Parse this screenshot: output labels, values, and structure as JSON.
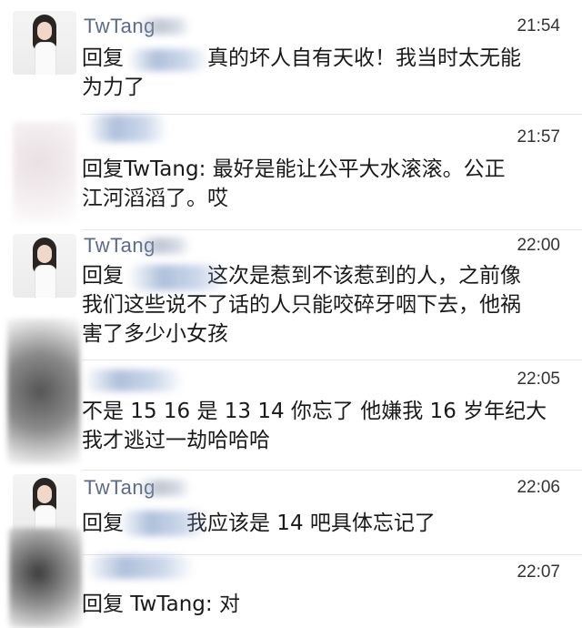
{
  "comments": [
    {
      "username": "TwTang",
      "time": "21:54",
      "text_line1": "回复　　　　真的坏人自有天收！我当时太无能",
      "text_line2": "为力了"
    },
    {
      "username": "",
      "time": "21:57",
      "text_line1": "回复TwTang: 最好是能让公平大水滚滚。公正",
      "text_line2": "江河滔滔了。哎"
    },
    {
      "username": "TwTang",
      "time": "22:00",
      "text_line1": "回复　　　　这次是惹到不该惹到的人，之前像",
      "text_line2": "我们这些说不了话的人只能咬碎牙咽下去，他祸",
      "text_line3": "害了多少小女孩"
    },
    {
      "username": "",
      "time": "22:05",
      "text_line1": "不是 15 16 是 13 14 你忘了 他嫌我 16 岁年纪大",
      "text_line2": "我才逃过一劫哈哈哈"
    },
    {
      "username": "TwTang",
      "time": "22:06",
      "text_line1": "回复　　　我应该是 14 吧具体忘记了"
    },
    {
      "username": "",
      "time": "22:07",
      "text_line1": "回复 TwTang: 对"
    }
  ]
}
